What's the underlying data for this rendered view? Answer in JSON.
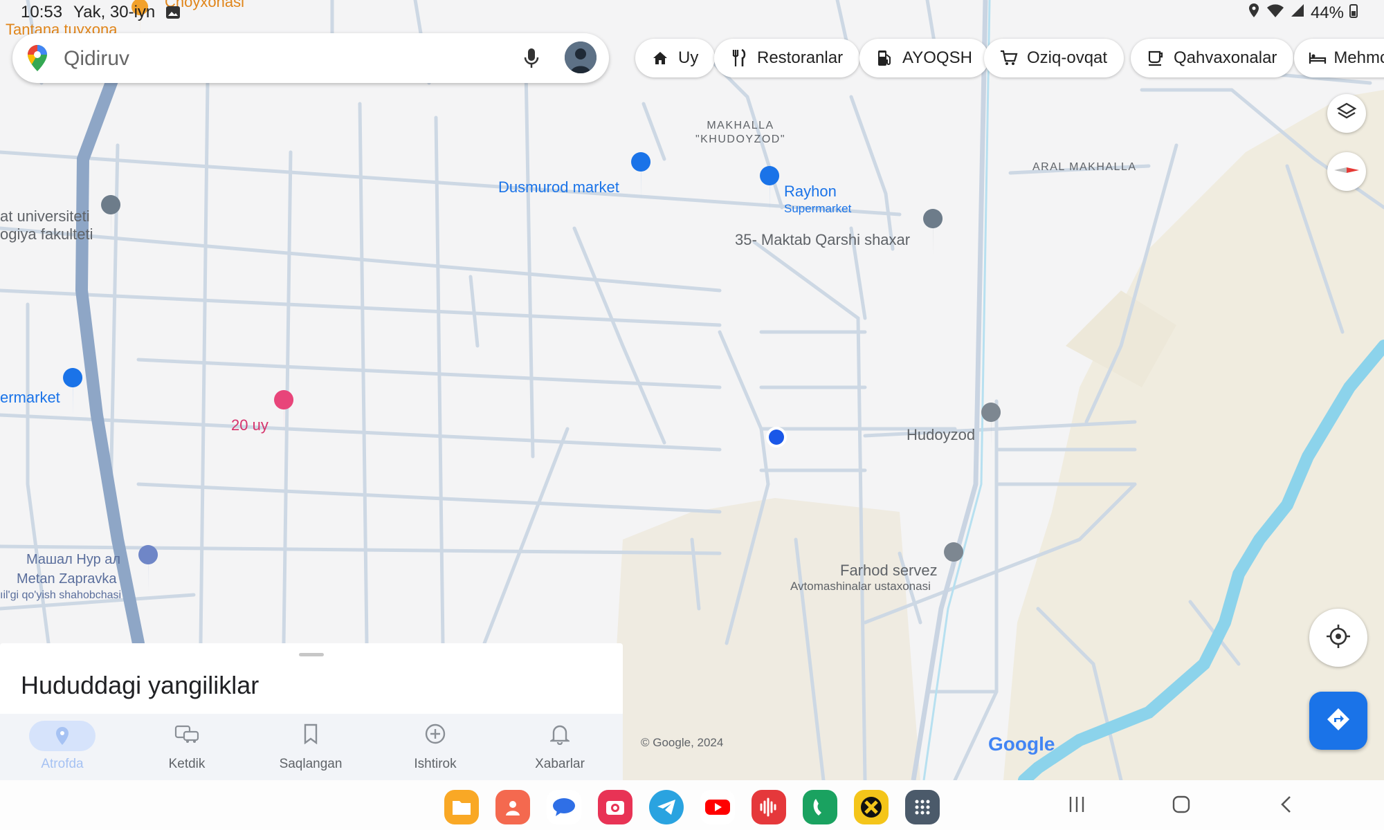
{
  "status_bar": {
    "time": "10:53",
    "date": "Yak, 30-iyn",
    "battery": "44%"
  },
  "search": {
    "placeholder": "Qidiruv"
  },
  "chips": [
    {
      "label": "Uy",
      "icon": "home-icon"
    },
    {
      "label": "Restoranlar",
      "icon": "restaurant-icon"
    },
    {
      "label": "AYOQSH",
      "icon": "gas-station-icon"
    },
    {
      "label": "Oziq-ovqat",
      "icon": "shopping-cart-icon"
    },
    {
      "label": "Qahvaxonalar",
      "icon": "coffee-icon"
    },
    {
      "label": "Mehmc",
      "icon": "hotel-icon"
    }
  ],
  "map_labels": {
    "top_poi": "Choyxonasi",
    "top_left_poi": "Tantana tuyxona",
    "univ_line1": "at universiteti",
    "univ_line2": "ogiya fakulteti",
    "dusmurod": "Dusmurod market",
    "rayhon": "Rayhon",
    "rayhon_sub": "Supermarket",
    "maktab": "35- Maktab Qarshi shaxar",
    "makhalla_line1": "MAKHALLA",
    "makhalla_line2": "\"KHUDOYZOD\"",
    "aral": "ARAL MAKHALLA",
    "supermarket_left": "ermarket",
    "uy20": "20 uy",
    "hudoyzod": "Hudoyzod",
    "mashal_line1": "Машал Нур ал",
    "mashal_line2": "Metan Zapravka",
    "mashal_line3": "ıil'gi qo'yish shahobchasi",
    "farhod": "Farhod servez",
    "farhod_sub": "Avtomashinalar ustaxonasi",
    "copyright": "© Google, 2024",
    "google_logo": "Google"
  },
  "sheet": {
    "title": "Hududdagi yangiliklar"
  },
  "bottom_nav": [
    {
      "label": "Atrofda",
      "icon": "location-pin-icon",
      "active": true
    },
    {
      "label": "Ketdik",
      "icon": "commute-icon",
      "active": false
    },
    {
      "label": "Saqlangan",
      "icon": "bookmark-icon",
      "active": false
    },
    {
      "label": "Ishtirok",
      "icon": "add-circle-icon",
      "active": false
    },
    {
      "label": "Xabarlar",
      "icon": "bell-icon",
      "active": false
    }
  ],
  "dock_apps": [
    {
      "name": "files",
      "color": "#f9a825"
    },
    {
      "name": "contacts",
      "color": "#f4694f"
    },
    {
      "name": "messages",
      "color": "#ffffff"
    },
    {
      "name": "camera",
      "color": "#e83355"
    },
    {
      "name": "telegram",
      "color": "#2aa3e0"
    },
    {
      "name": "youtube",
      "color": "#ffffff"
    },
    {
      "name": "voice-recorder",
      "color": "#e5383b"
    },
    {
      "name": "phone",
      "color": "#1aa260"
    },
    {
      "name": "game-app",
      "color": "#f4c51a"
    },
    {
      "name": "app-drawer",
      "color": "#4b5a6a"
    }
  ],
  "colors": {
    "accent_blue": "#1a73e8",
    "highway": "#8ea6c6",
    "river": "#8cd3eb",
    "field": "#f0ece2"
  }
}
